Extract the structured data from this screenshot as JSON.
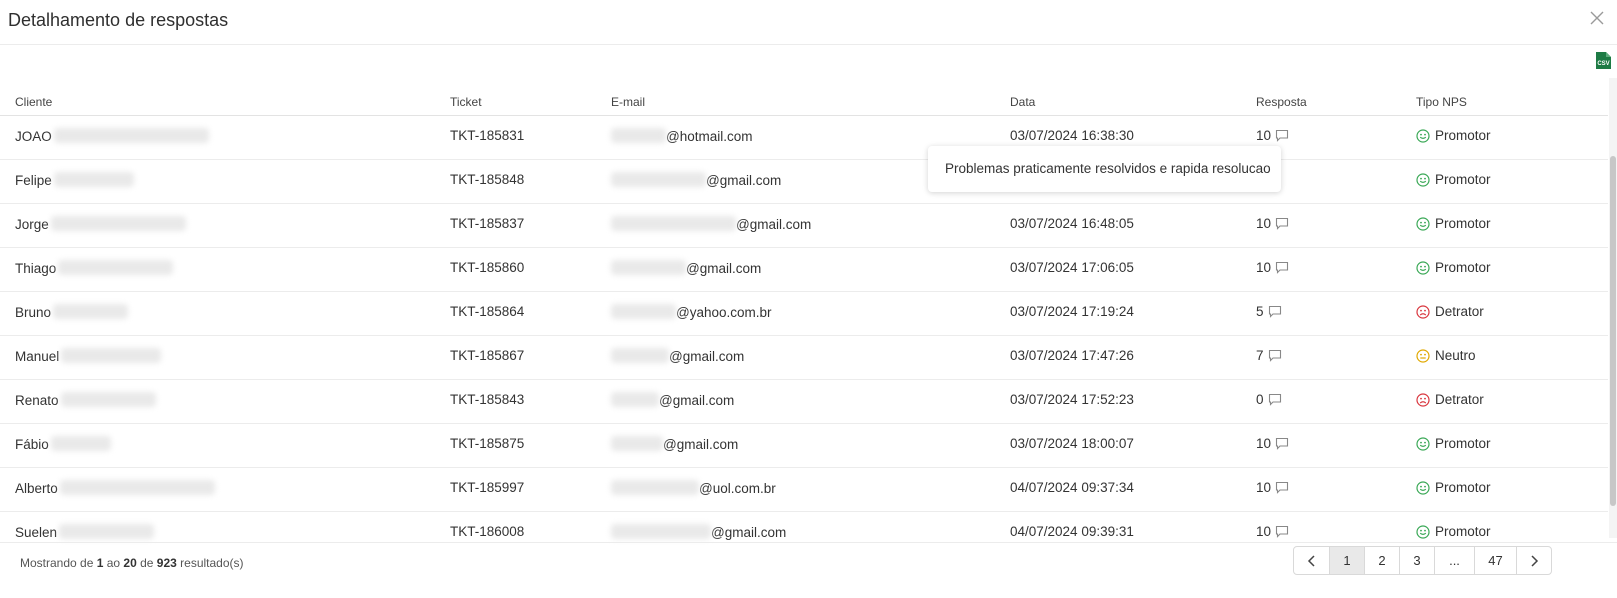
{
  "modal": {
    "title": "Detalhamento de respostas"
  },
  "toolbar": {
    "export_icon": "csv-file-icon",
    "export_label": "CSV"
  },
  "table": {
    "columns": [
      "Cliente",
      "Ticket",
      "E-mail",
      "Data",
      "Resposta",
      "Tipo NPS"
    ],
    "rows": [
      {
        "client": "JOAO",
        "ticket": "TKT-185831",
        "email_domain": "@hotmail.com",
        "date": "03/07/2024 16:38:30",
        "score": "10",
        "nps": "Promotor",
        "nps_type": "promotor"
      },
      {
        "client": "Felipe",
        "ticket": "TKT-185848",
        "email_domain": "@gmail.com",
        "date": "",
        "score": "",
        "nps": "Promotor",
        "nps_type": "promotor"
      },
      {
        "client": "Jorge",
        "ticket": "TKT-185837",
        "email_domain": "@gmail.com",
        "date": "03/07/2024 16:48:05",
        "score": "10",
        "nps": "Promotor",
        "nps_type": "promotor"
      },
      {
        "client": "Thiago",
        "ticket": "TKT-185860",
        "email_domain": "@gmail.com",
        "date": "03/07/2024 17:06:05",
        "score": "10",
        "nps": "Promotor",
        "nps_type": "promotor"
      },
      {
        "client": "Bruno",
        "ticket": "TKT-185864",
        "email_domain": "@yahoo.com.br",
        "date": "03/07/2024 17:19:24",
        "score": "5",
        "nps": "Detrator",
        "nps_type": "detrator"
      },
      {
        "client": "Manuel",
        "ticket": "TKT-185867",
        "email_domain": "@gmail.com",
        "date": "03/07/2024 17:47:26",
        "score": "7",
        "nps": "Neutro",
        "nps_type": "neutro"
      },
      {
        "client": "Renato",
        "ticket": "TKT-185843",
        "email_domain": "@gmail.com",
        "date": "03/07/2024 17:52:23",
        "score": "0",
        "nps": "Detrator",
        "nps_type": "detrator"
      },
      {
        "client": "Fábio",
        "ticket": "TKT-185875",
        "email_domain": "@gmail.com",
        "date": "03/07/2024 18:00:07",
        "score": "10",
        "nps": "Promotor",
        "nps_type": "promotor"
      },
      {
        "client": "Alberto",
        "ticket": "TKT-185997",
        "email_domain": "@uol.com.br",
        "date": "04/07/2024 09:37:34",
        "score": "10",
        "nps": "Promotor",
        "nps_type": "promotor"
      },
      {
        "client": "Suelen",
        "ticket": "TKT-186008",
        "email_domain": "@gmail.com",
        "date": "04/07/2024 09:39:31",
        "score": "10",
        "nps": "Promotor",
        "nps_type": "promotor"
      }
    ]
  },
  "tooltip": {
    "text": "Problemas praticamente resolvidos e rapida resolucao"
  },
  "footer": {
    "prefix": "Mostrando de ",
    "from": "1",
    "mid1": " ao ",
    "to": "20",
    "mid2": " de ",
    "total": "923",
    "suffix": " resultado(s)"
  },
  "pagination": {
    "pages": [
      "1",
      "2",
      "3",
      "...",
      "47"
    ],
    "active": "1",
    "prev_icon": "chevron-left-icon",
    "next_icon": "chevron-right-icon"
  },
  "colors": {
    "promotor": "#3aa856",
    "detrator": "#d9363e",
    "neutro": "#e0a800",
    "csv": "#1e7b45"
  }
}
